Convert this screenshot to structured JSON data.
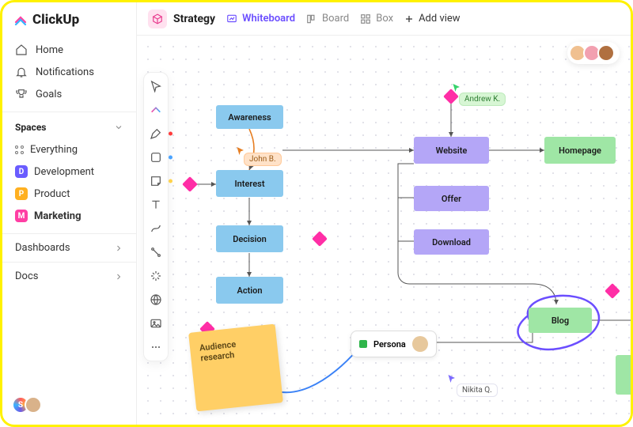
{
  "app": {
    "name": "ClickUp"
  },
  "nav": {
    "home": "Home",
    "notifications": "Notifications",
    "goals": "Goals"
  },
  "spaces": {
    "header": "Spaces",
    "everything": "Everything",
    "items": [
      {
        "letter": "D",
        "label": "Development",
        "color": "#6a5cff"
      },
      {
        "letter": "P",
        "label": "Product",
        "color": "#ffb020"
      },
      {
        "letter": "M",
        "label": "Marketing",
        "color": "#ff3fa4"
      }
    ]
  },
  "side_sections": {
    "dashboards": "Dashboards",
    "docs": "Docs"
  },
  "viewbar": {
    "project": "Strategy",
    "tabs": {
      "whiteboard": "Whiteboard",
      "board": "Board",
      "box": "Box"
    },
    "add_view": "Add view"
  },
  "canvas": {
    "avatars_count": 3,
    "nodes": {
      "awareness": "Awareness",
      "interest": "Interest",
      "decision": "Decision",
      "action": "Action",
      "website": "Website",
      "offer": "Offer",
      "download": "Download",
      "homepage": "Homepage",
      "blog": "Blog",
      "persona": "Persona"
    },
    "sticky": "Audience research",
    "user_tags": {
      "john": "John B.",
      "andrew": "Andrew K.",
      "nikita": "Nikita Q."
    }
  }
}
